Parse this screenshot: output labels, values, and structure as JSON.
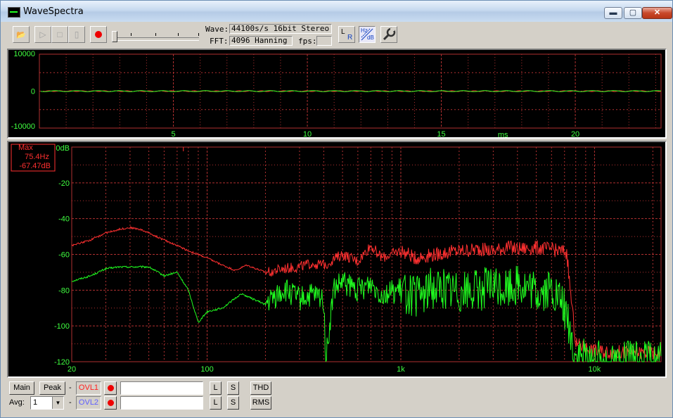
{
  "window": {
    "title": "WaveSpectra"
  },
  "titlebar": {
    "minimize": "▬",
    "maximize": "▢",
    "close": "✕"
  },
  "toolbar": {
    "open_icon": "📂",
    "play_icon": "▷",
    "stop_icon": "□",
    "pause_icon": "▯",
    "wave_label": "Wave:",
    "wave_value": "44100s/s 16bit Stereo",
    "fft_label": "FFT:",
    "fft_value": "4096 Hanning",
    "fps_label": "fps:",
    "fps_value": "",
    "lr_label_l": "L",
    "lr_label_r": "R",
    "hz_label": "Hz",
    "db_label": "dB"
  },
  "wave_panel": {
    "y_ticks": [
      "10000",
      "0",
      "-10000"
    ],
    "x_ticks": [
      "5",
      "10",
      "15",
      "20"
    ],
    "x_unit": "ms"
  },
  "spectrum_panel": {
    "y_ticks": [
      "0dB",
      "-20",
      "-40",
      "-60",
      "-80",
      "-100",
      "-120"
    ],
    "x_ticks": [
      "20",
      "100",
      "1k",
      "10k"
    ],
    "max_label": "Max",
    "max_freq": "75.4Hz",
    "max_db": "-67.47dB"
  },
  "bottom": {
    "main_label": "Main",
    "peak_label": "Peak",
    "dash1": "-",
    "ovl1_label": "OVL1",
    "l1_label": "L",
    "s1_label": "S",
    "thd_label": "THD",
    "avg_label": "Avg:",
    "avg_value": "1",
    "dash2": "-",
    "ovl2_label": "OVL2",
    "l2_label": "L",
    "s2_label": "S",
    "rms_label": "RMS"
  },
  "colors": {
    "left_channel": "#ff3030",
    "right_channel": "#20ff20",
    "grid": "#b03030",
    "axis_text": "#40ff40",
    "ovl1": "#ff2020",
    "ovl2": "#6060ff"
  },
  "chart_data": {
    "type": "line",
    "xscale": "log",
    "xlim": [
      20,
      22050
    ],
    "ylim": [
      -120,
      0
    ],
    "x_ticks": [
      "20",
      "100",
      "1k",
      "10k"
    ],
    "y_ticks": [
      "0dB",
      "-20",
      "-40",
      "-60",
      "-80",
      "-100",
      "-120"
    ],
    "series": [
      {
        "color": "#ff3030",
        "x": [
          20,
          25,
          30,
          35,
          40,
          45,
          50,
          60,
          70,
          80,
          100,
          120,
          140,
          160,
          200,
          250,
          300,
          350,
          400,
          500,
          600,
          700,
          800,
          1000,
          1200,
          1500,
          2000,
          2500,
          3000,
          3500,
          4000,
          5000,
          6000,
          6500,
          7000,
          7200,
          7500,
          8000,
          10000,
          15000,
          22050
        ],
        "y": [
          -55,
          -52,
          -48,
          -46,
          -45,
          -46,
          -48,
          -52,
          -55,
          -58,
          -62,
          -66,
          -69,
          -66,
          -70,
          -68,
          -67,
          -65,
          -66,
          -60,
          -64,
          -55,
          -62,
          -58,
          -62,
          -60,
          -58,
          -57,
          -58,
          -56,
          -57,
          -56,
          -57,
          -58,
          -58,
          -60,
          -80,
          -110,
          -114,
          -115,
          -115
        ]
      },
      {
        "color": "#20ff20",
        "x": [
          20,
          25,
          30,
          35,
          40,
          50,
          60,
          70,
          80,
          90,
          100,
          120,
          150,
          200,
          250,
          300,
          350,
          400,
          410,
          450,
          500,
          600,
          700,
          800,
          1000,
          1200,
          1500,
          2000,
          2500,
          3000,
          3500,
          4000,
          5000,
          6000,
          6500,
          7000,
          7200,
          7500,
          8000,
          10000,
          15000,
          22050
        ],
        "y": [
          -75,
          -72,
          -68,
          -67,
          -67,
          -67,
          -72,
          -70,
          -80,
          -98,
          -92,
          -90,
          -82,
          -88,
          -80,
          -85,
          -83,
          -85,
          -120,
          -80,
          -76,
          -80,
          -76,
          -82,
          -80,
          -84,
          -78,
          -80,
          -80,
          -78,
          -79,
          -76,
          -82,
          -80,
          -85,
          -90,
          -95,
          -105,
          -118,
          -120,
          -120,
          -120
        ]
      }
    ]
  }
}
